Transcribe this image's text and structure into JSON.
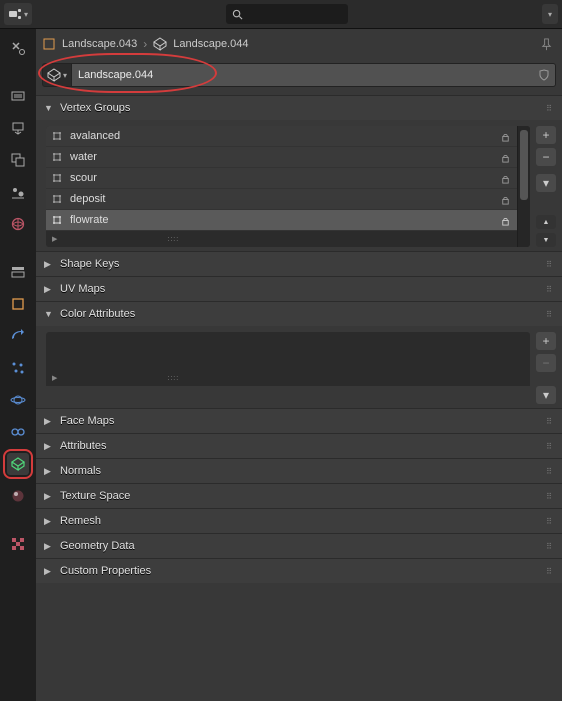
{
  "topbar": {
    "search_placeholder": ""
  },
  "breadcrumb": {
    "obj": "Landscape.043",
    "data": "Landscape.044"
  },
  "datablock": {
    "name": "Landscape.044"
  },
  "panels": {
    "vertex_groups": {
      "label": "Vertex Groups",
      "expanded": true
    },
    "shape_keys": {
      "label": "Shape Keys",
      "expanded": false
    },
    "uv_maps": {
      "label": "UV Maps",
      "expanded": false
    },
    "color_attributes": {
      "label": "Color Attributes",
      "expanded": true
    },
    "face_maps": {
      "label": "Face Maps",
      "expanded": false
    },
    "attributes": {
      "label": "Attributes",
      "expanded": false
    },
    "normals": {
      "label": "Normals",
      "expanded": false
    },
    "texture_space": {
      "label": "Texture Space",
      "expanded": false
    },
    "remesh": {
      "label": "Remesh",
      "expanded": false
    },
    "geometry_data": {
      "label": "Geometry Data",
      "expanded": false
    },
    "custom_properties": {
      "label": "Custom Properties",
      "expanded": false
    }
  },
  "vertex_groups": {
    "items": [
      {
        "name": "avalanced",
        "active": false
      },
      {
        "name": "water",
        "active": false
      },
      {
        "name": "scour",
        "active": false
      },
      {
        "name": "deposit",
        "active": false
      },
      {
        "name": "flowrate",
        "active": true
      }
    ]
  },
  "icons": {
    "plus": "+",
    "minus": "−",
    "tri_right": "▶",
    "tri_down": "▾",
    "dots": "⋮⋮",
    "up": "▲",
    "down": "▼"
  },
  "sidebar_tabs": [
    "tool",
    "render",
    "output",
    "view-layer",
    "scene",
    "world",
    "object",
    "modifier",
    "particle",
    "physics",
    "constraint",
    "object-data",
    "material",
    "texture"
  ]
}
